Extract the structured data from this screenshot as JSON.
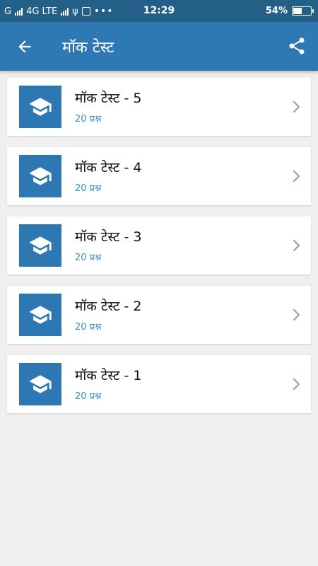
{
  "status_bar": {
    "carrier": "G",
    "network": "4G LTE",
    "time": "12:29",
    "battery": "54%",
    "battery_level": 0.54
  },
  "app_bar": {
    "back_icon": "arrow-left-icon",
    "title": "मॉक टेस्ट",
    "share_icon": "share-icon"
  },
  "tests": [
    {
      "title": "मॉक टेस्ट - 5",
      "subtitle": "20 प्रश्न"
    },
    {
      "title": "मॉक टेस्ट - 4",
      "subtitle": "20 प्रश्न"
    },
    {
      "title": "मॉक टेस्ट - 3",
      "subtitle": "20 प्रश्न"
    },
    {
      "title": "मॉक टेस्ट - 2",
      "subtitle": "20 प्रश्न"
    },
    {
      "title": "मॉक टेस्ट - 1",
      "subtitle": "20 प्रश्न"
    }
  ],
  "colors": {
    "status_bar": "#245f88",
    "app_bar": "#2e78b4",
    "thumbnail": "#2d77b3",
    "subtitle": "#3b8bc4",
    "background": "#efefef"
  }
}
